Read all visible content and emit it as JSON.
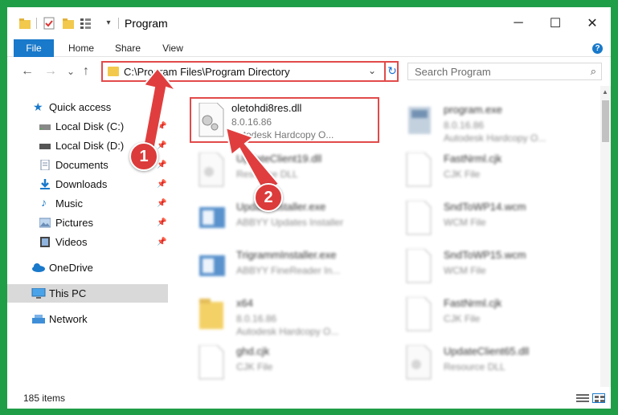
{
  "window": {
    "title": "Program",
    "controls": {
      "minimize": "─",
      "maximize": "☐",
      "close": "✕"
    }
  },
  "ribbon": {
    "tabs": [
      "File",
      "Home",
      "Share",
      "View"
    ],
    "help": "?"
  },
  "navigation": {
    "back": "←",
    "forward": "→",
    "recent": "⌄",
    "up": "↑",
    "address": "C:\\Program Files\\Program Directory",
    "search_placeholder": "Search Program"
  },
  "sidebar": {
    "items": [
      {
        "label": "Quick access",
        "icon": "star-icon",
        "pinned": false
      },
      {
        "label": "Local Disk (C:)",
        "icon": "drive-icon",
        "pinned": true
      },
      {
        "label": "Local Disk (D:)",
        "icon": "drive-icon",
        "pinned": true
      },
      {
        "label": "Documents",
        "icon": "documents-icon",
        "pinned": true
      },
      {
        "label": "Downloads",
        "icon": "download-icon",
        "pinned": true
      },
      {
        "label": "Music",
        "icon": "music-icon",
        "pinned": true
      },
      {
        "label": "Pictures",
        "icon": "pictures-icon",
        "pinned": true
      },
      {
        "label": "Videos",
        "icon": "videos-icon",
        "pinned": true
      },
      {
        "label": "OneDrive",
        "icon": "cloud-icon",
        "pinned": false
      },
      {
        "label": "This PC",
        "icon": "computer-icon",
        "pinned": false,
        "selected": true
      },
      {
        "label": "Network",
        "icon": "network-icon",
        "pinned": false
      }
    ]
  },
  "files": [
    {
      "name": "oletohdi8res.dll",
      "line2": "8.0.16.86",
      "line3": "Autodesk Hardcopy O...",
      "type": "dll",
      "highlighted": true
    },
    {
      "name": "program.exe",
      "line2": "8.0.16.86",
      "line3": "Autodesk Hardcopy O...",
      "type": "exe"
    },
    {
      "name": "UpdateClient19.dll",
      "line2": "Resource DLL",
      "line3": "",
      "type": "dll"
    },
    {
      "name": "FastNrml.cjk",
      "line2": "CJK File",
      "line3": "",
      "type": "file"
    },
    {
      "name": "UpdateInstaller.exe",
      "line2": "ABBYY Updates Installer",
      "line3": "",
      "type": "installer"
    },
    {
      "name": "SndToWP14.wcm",
      "line2": "WCM File",
      "line3": "",
      "type": "file"
    },
    {
      "name": "TrigrammInstaller.exe",
      "line2": "ABBYY FineReader In...",
      "line3": "",
      "type": "installer"
    },
    {
      "name": "SndToWP15.wcm",
      "line2": "WCM File",
      "line3": "",
      "type": "file"
    },
    {
      "name": "x64",
      "line2": "8.0.16.86",
      "line3": "Autodesk Hardcopy O...",
      "type": "folder"
    },
    {
      "name": "FastNrml.cjk",
      "line2": "CJK File",
      "line3": "",
      "type": "file"
    },
    {
      "name": "ghd.cjk",
      "line2": "CJK File",
      "line3": "",
      "type": "file"
    },
    {
      "name": "UpdateClient65.dll",
      "line2": "Resource DLL",
      "line3": "",
      "type": "dll"
    }
  ],
  "status": {
    "item_count": "185 items"
  },
  "callouts": [
    "1",
    "2"
  ],
  "colors": {
    "accent": "#1979ca",
    "highlight": "#e24a4a",
    "background": "#1f9d47"
  }
}
